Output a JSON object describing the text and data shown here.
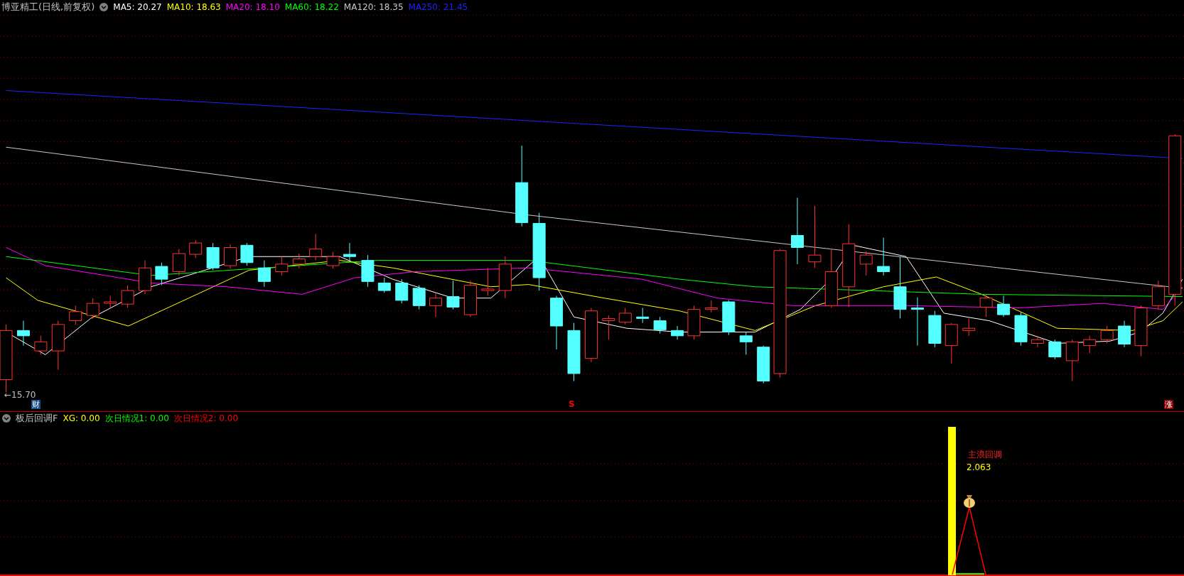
{
  "header": {
    "title": "博亚精工(日线,前复权)",
    "indicators": [
      {
        "text": "MA5: 20.27",
        "color": "#ffffff"
      },
      {
        "text": "MA10: 18.63",
        "color": "#ffff00"
      },
      {
        "text": "MA20: 18.10",
        "color": "#ff00ff"
      },
      {
        "text": "MA60: 18.22",
        "color": "#00ff00"
      },
      {
        "text": "MA120: 18.35",
        "color": "#c8c8c8"
      },
      {
        "text": "MA250: 21.45",
        "color": "#2020ff"
      }
    ]
  },
  "price_chart": {
    "low_label": "←15.70",
    "markers": [
      {
        "text": "财",
        "kind": "badge",
        "color": "#1a4f8f"
      },
      {
        "text": "S",
        "kind": "signal",
        "color": "#ff0000"
      },
      {
        "text": "涨",
        "kind": "badge",
        "color": "#8b0000"
      }
    ]
  },
  "indicator": {
    "name": "板后回调F",
    "values": [
      {
        "text": "XG: 0.00",
        "color": "#ffff00"
      },
      {
        "text": "次日情况1: 0.00",
        "color": "#00ff00"
      },
      {
        "text": "次日情况2: 0.00",
        "color": "#ff0000"
      }
    ],
    "signal_label": "主浪回调",
    "signal_value": "2.063"
  }
}
